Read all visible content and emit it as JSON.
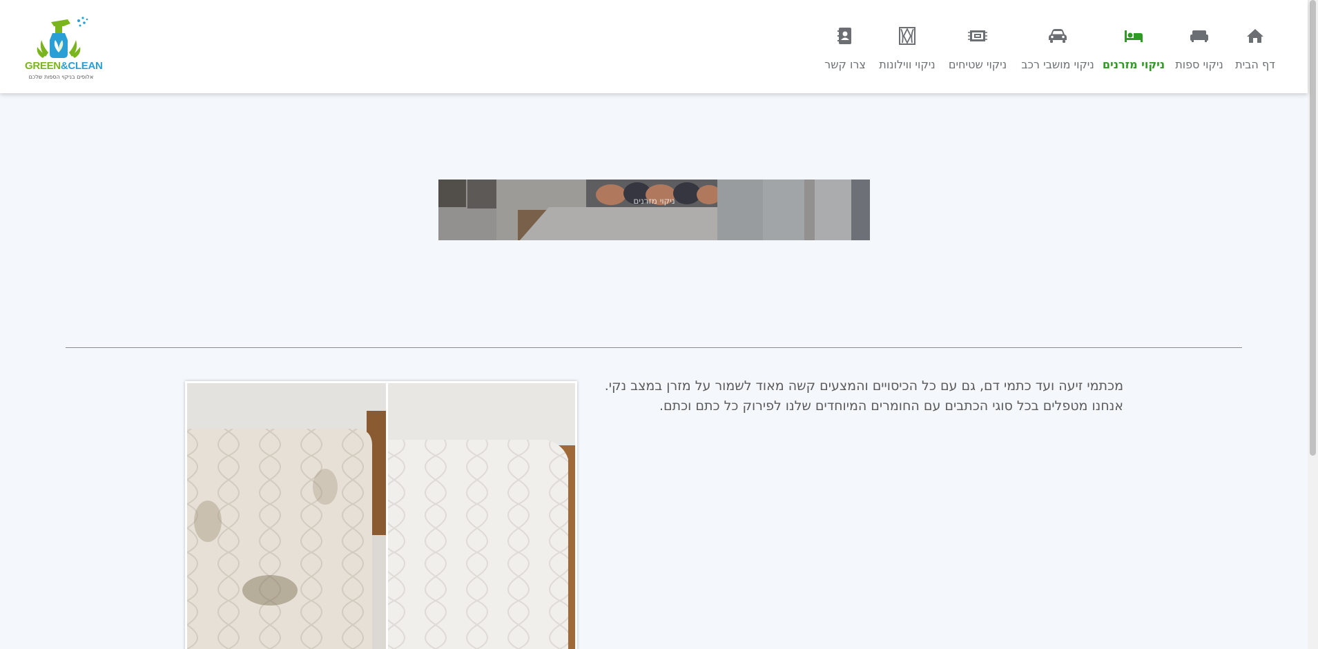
{
  "brand": {
    "name_part1": "GREEN",
    "name_amp": "&",
    "name_part2": "CLEAN",
    "tagline": "אלופים בניקוי הספות שלכם"
  },
  "nav": {
    "items": [
      {
        "label": "דף הבית",
        "icon": "home-icon"
      },
      {
        "label": "ניקוי ספות",
        "icon": "sofa-icon"
      },
      {
        "label": "ניקוי מזרנים",
        "icon": "bed-icon",
        "active": true
      },
      {
        "label": "ניקוי מושבי רכב",
        "icon": "car-icon"
      },
      {
        "label": "ניקוי שטיחים",
        "icon": "rug-icon"
      },
      {
        "label": "ניקוי ווילונות",
        "icon": "curtain-icon"
      },
      {
        "label": "צרו קשר",
        "icon": "contact-book-icon"
      }
    ],
    "active_color": "#2e9b22",
    "icon_color": "#6b6f73"
  },
  "banner": {
    "caption": "ניקוי מזרנים"
  },
  "content": {
    "line1": "מכתמי זיעה ועד כתמי דם, גם עם כל הכיסויים והמצעים קשה מאוד לשמור על מזרן במצב נקי.",
    "line2": "אנחנו מטפלים בכל סוגי הכתבים עם החומרים המיוחדים שלנו לפירוק כל כתם וכתם."
  },
  "colors": {
    "background": "#f4f8fc",
    "header": "#ffffff",
    "brand_green": "#7ab51d",
    "brand_blue": "#2a9fd6"
  }
}
